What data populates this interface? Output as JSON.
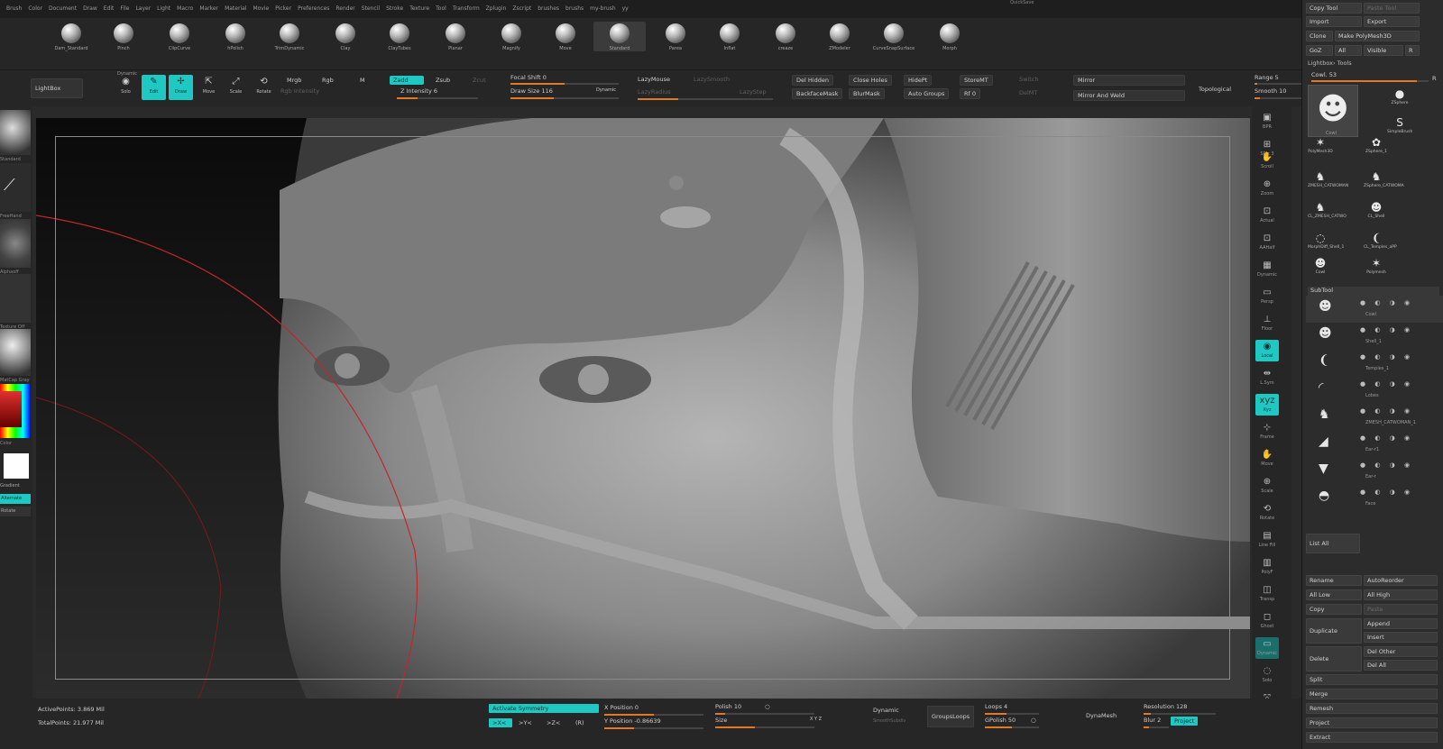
{
  "menu": [
    "Brush",
    "Color",
    "Document",
    "Draw",
    "Edit",
    "File",
    "Layer",
    "Light",
    "Macro",
    "Marker",
    "Material",
    "Movie",
    "Picker",
    "Preferences",
    "Render",
    "Stencil",
    "Stroke",
    "Texture",
    "Tool",
    "Transform",
    "Zplugin",
    "Zscript",
    "brushes",
    "brushs",
    "my-brush",
    "yy"
  ],
  "brushes": [
    {
      "label": "Dam_Standard"
    },
    {
      "label": "Pinch"
    },
    {
      "label": "ClipCurve"
    },
    {
      "label": "hPolish"
    },
    {
      "label": "TrimDynamic"
    },
    {
      "label": "Clay"
    },
    {
      "label": "ClayTubes"
    },
    {
      "label": "Planar"
    },
    {
      "label": "Magnify"
    },
    {
      "label": "Move"
    },
    {
      "label": "Standard"
    },
    {
      "label": "Parea"
    },
    {
      "label": "Inflat"
    },
    {
      "label": "creaze"
    },
    {
      "label": "ZModeler"
    },
    {
      "label": "CurveSnapSurface"
    },
    {
      "label": "Morph"
    }
  ],
  "toolbar": {
    "lightbox": "LightBox",
    "dynamic": "Dynamic",
    "solo": "Solo",
    "edit": "Edit",
    "draw": "Draw",
    "move": "Move",
    "scale": "Scale",
    "rotate": "Rotate",
    "mrgb": "Mrgb",
    "rgb": "Rgb",
    "m": "M",
    "rgb_intensity": "Rgb Intensity",
    "zadd": "Zadd",
    "zsub": "Zsub",
    "zcut": "Zcut",
    "z_intensity": "Z Intensity 6",
    "focal_shift": "Focal Shift 0",
    "draw_size": "Draw Size 116",
    "dynamic2": "Dynamic",
    "lazymouse": "LazyMouse",
    "lazysmooth": "LazySmooth",
    "lazyradius": "LazyRadius",
    "lazystep": "LazyStep",
    "del_hidden": "Del Hidden",
    "close_holes": "Close Holes",
    "hidept": "HidePt",
    "storemt": "StoreMT",
    "switch": "Switch",
    "backfacemask": "BackfaceMask",
    "blurmask": "BlurMask",
    "auto_groups": "Auto Groups",
    "rf": "Rf 0",
    "delmt": "DelMT",
    "mirror": "Mirror",
    "mirror_weld": "Mirror And Weld",
    "topological": "Topological",
    "range": "Range 5",
    "smooth": "Smooth 10",
    "quicksave": "QuickSave"
  },
  "left": [
    "Standard",
    "FreeHand",
    "Alphaoff",
    "Texture Off",
    "MatCap Gray",
    "Color",
    "Gradient",
    "Switch Color",
    "Alternate",
    "Rotate"
  ],
  "right_shelf": [
    "BPR",
    "SPix 3",
    "Scroll",
    "Zoom",
    "Actual",
    "AAHalf",
    "Dynamic",
    "Persp",
    "Floor",
    "Local",
    "L.Sym",
    "Xyz",
    "Frame",
    "Move",
    "Scale",
    "Rotate",
    "Line Fill",
    "PolyF",
    "Transp",
    "Ghost",
    "Dynamic",
    "Solo",
    "Xpose"
  ],
  "tool_panel": {
    "copy_tool": "Copy Tool",
    "paste_tool": "Paste Tool",
    "import": "Import",
    "export": "Export",
    "clone": "Clone",
    "make_polymesh": "Make PolyMesh3D",
    "goz": "GoZ",
    "all": "All",
    "visible": "Visible",
    "r": "R",
    "lightbox_tools": "Lightbox› Tools",
    "cowl": "Cowl. 53",
    "r2": "R",
    "thumbs": [
      {
        "label": "Cowl",
        "glyph": "☻"
      },
      {
        "label": "ZSphere",
        "glyph": "●"
      },
      {
        "label": "SimpleBrush",
        "glyph": "S"
      },
      {
        "label": "PolyMesh3D",
        "glyph": "✶"
      },
      {
        "label": "ZSphere_1",
        "glyph": "✿"
      },
      {
        "label": "ZMESH_CATWOMAN",
        "glyph": "♞"
      },
      {
        "label": "ZSphere_CATWOMA",
        "glyph": "♞"
      },
      {
        "label": "CL_ZMESH_CATWO",
        "glyph": "♞"
      },
      {
        "label": "CL_Shell",
        "glyph": "☻"
      },
      {
        "label": "MorphDiff_Shell_1",
        "glyph": "◌"
      },
      {
        "label": "CL_Temples_aPP",
        "glyph": "❨"
      },
      {
        "label": "Cowl",
        "glyph": "☻"
      },
      {
        "label": "Polymesh",
        "glyph": "✶"
      }
    ],
    "subtool": "SubTool",
    "subtools": [
      {
        "name": "Cowl",
        "glyph": "☻"
      },
      {
        "name": "Shell_1",
        "glyph": "☻"
      },
      {
        "name": "Temples_1",
        "glyph": "❨"
      },
      {
        "name": "Lobes",
        "glyph": "◜"
      },
      {
        "name": "ZMESH_CATWOMAN_1",
        "glyph": "♞"
      },
      {
        "name": "Ear-r1",
        "glyph": "◢"
      },
      {
        "name": "Ear-r",
        "glyph": "▼"
      },
      {
        "name": "Face",
        "glyph": "◓"
      }
    ],
    "list_all": "List All",
    "rename": "Rename",
    "autoreorder": "AutoReorder",
    "all_low": "All Low",
    "all_high": "All High",
    "copy": "Copy",
    "paste": "Paste",
    "duplicate": "Duplicate",
    "append": "Append",
    "insert": "Insert",
    "delete": "Delete",
    "del_other": "Del Other",
    "del_all": "Del All",
    "split": "Split",
    "merge": "Merge",
    "remesh": "Remesh",
    "project": "Project",
    "extract": "Extract"
  },
  "bottom": {
    "active_points": "ActivePoints: 3.869 Mil",
    "total_points": "TotalPoints: 21.977 Mil",
    "activate_symmetry": "Activate Symmetry",
    "x_btn": ">X<",
    "y_btn": ">Y<",
    "z_btn": ">Z<",
    "r_btn": "(R)",
    "x_position": "X Position 0",
    "y_position": "Y Position -0.86639",
    "polish": "Polish 10",
    "size": "Size",
    "xyz": "X Y Z",
    "dynamic": "Dynamic",
    "smooth_subdiv": "SmoothSubdiv",
    "groups_loops": "GroupsLoops",
    "loops": "Loops 4",
    "gpolish": "GPolish 50",
    "dynamesh": "DynaMesh",
    "resolution": "Resolution 128",
    "blur": "Blur 2",
    "project": "Project"
  },
  "colors": {
    "accent": "#1fc9c3",
    "slider": "#e0782a",
    "bg": "#262626"
  },
  "sliders": {
    "focal_shift": 0.5,
    "draw_size": 0.4,
    "z_intensity": 0.25,
    "lazy": 0.3,
    "range": 0.05,
    "smooth": 0.1,
    "polish": 0.1,
    "gpolish": 0.5,
    "resolution": 0.1,
    "blur": 0.2,
    "x_pos": 0.5,
    "y_pos": 0.3
  }
}
